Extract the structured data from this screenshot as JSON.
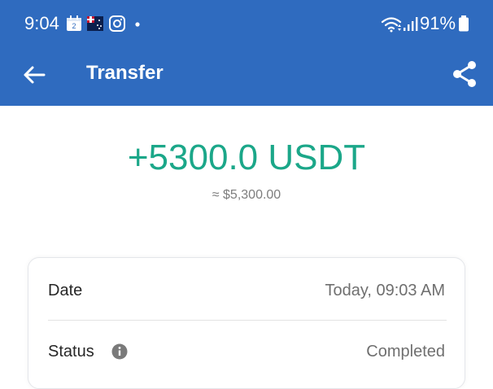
{
  "status_bar": {
    "time": "9:04",
    "battery_percent": "91%",
    "notification_icons": [
      "calendar-icon",
      "flag-icon",
      "instagram-icon",
      "dot-icon"
    ],
    "system_icons": [
      "wifi-icon",
      "signal-icon",
      "battery-icon"
    ],
    "calendar_day": "2"
  },
  "app_bar": {
    "title": "Transfer",
    "back_icon": "arrow-left-icon",
    "share_icon": "share-icon"
  },
  "transfer": {
    "amount": "+5300.0 USDT",
    "approx_value": "≈ $5,300.00"
  },
  "details": {
    "rows": [
      {
        "label": "Date",
        "value": "Today, 09:03 AM"
      },
      {
        "label": "Status",
        "value": "Completed",
        "info_icon": "info-icon"
      }
    ]
  },
  "colors": {
    "header_bg": "#2f6bbf",
    "amount_green": "#1ba789",
    "muted_text": "#7d7d7d"
  }
}
